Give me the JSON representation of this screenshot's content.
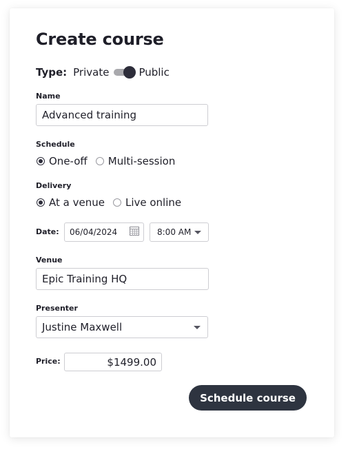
{
  "title": "Create course",
  "type": {
    "label": "Type:",
    "option_left": "Private",
    "option_right": "Public",
    "selected": "Public"
  },
  "name": {
    "label": "Name",
    "value": "Advanced training"
  },
  "schedule": {
    "label": "Schedule",
    "options": [
      "One-off",
      "Multi-session"
    ],
    "selected": "One-off"
  },
  "delivery": {
    "label": "Delivery",
    "options": [
      "At a venue",
      "Live online"
    ],
    "selected": "At a venue"
  },
  "date": {
    "label": "Date:",
    "value": "06/04/2024",
    "time": "8:00 AM"
  },
  "venue": {
    "label": "Venue",
    "value": "Epic Training HQ"
  },
  "presenter": {
    "label": "Presenter",
    "value": "Justine Maxwell"
  },
  "price": {
    "label": "Price:",
    "value": "$1499.00"
  },
  "submit_label": "Schedule course",
  "icons": {
    "calendar": "calendar-icon",
    "dropdown": "chevron-down-icon"
  },
  "colors": {
    "accent": "#2e3440",
    "text": "#1f1f29",
    "border": "#cdcdd2"
  }
}
